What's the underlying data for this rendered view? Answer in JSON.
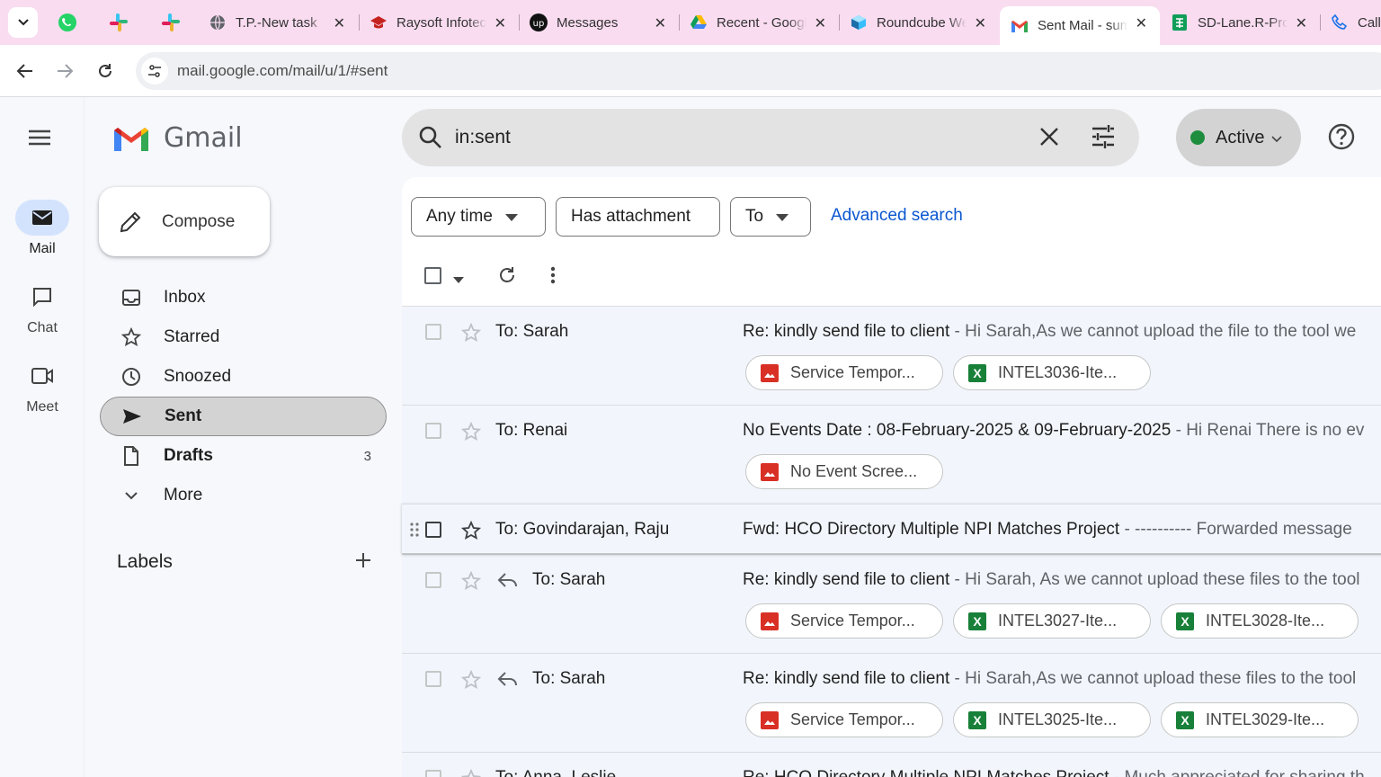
{
  "browser": {
    "tabs": [
      {
        "title": "T.P.-New task",
        "icon": "globe-icon"
      },
      {
        "title": "Raysoft Infotech",
        "icon": "graduation-cap-icon"
      },
      {
        "title": "Messages",
        "icon": "upwork-icon"
      },
      {
        "title": "Recent - Google Drive",
        "icon": "google-drive-icon"
      },
      {
        "title": "Roundcube Webmail",
        "icon": "roundcube-icon"
      },
      {
        "title": "Sent Mail - sumit",
        "icon": "gmail-icon",
        "active": true
      },
      {
        "title": "SD-Lane.R-Pro",
        "icon": "google-sheets-icon"
      },
      {
        "title": "Call",
        "icon": "phone-icon"
      }
    ],
    "url": "mail.google.com/mail/u/1/#sent"
  },
  "rail": {
    "items": [
      {
        "label": "Mail",
        "icon": "mail-icon",
        "active": true
      },
      {
        "label": "Chat",
        "icon": "chat-icon"
      },
      {
        "label": "Meet",
        "icon": "video-icon"
      }
    ]
  },
  "app": {
    "name": "Gmail"
  },
  "compose": {
    "label": "Compose"
  },
  "nav": {
    "items": [
      {
        "label": "Inbox",
        "icon": "inbox-icon"
      },
      {
        "label": "Starred",
        "icon": "star-icon"
      },
      {
        "label": "Snoozed",
        "icon": "clock-icon"
      },
      {
        "label": "Sent",
        "icon": "send-icon",
        "active": true
      },
      {
        "label": "Drafts",
        "icon": "file-icon",
        "count": "3"
      },
      {
        "label": "More",
        "icon": "chevron-down-icon"
      }
    ]
  },
  "labels": {
    "title": "Labels"
  },
  "search": {
    "query": "in:sent"
  },
  "status": {
    "label": "Active",
    "color": "#1e8e3e"
  },
  "filters": {
    "any_time": "Any time",
    "has_attachment": "Has attachment",
    "to": "To",
    "advanced": "Advanced search"
  },
  "emails": [
    {
      "sender": "To: Sarah",
      "subject": "Re: kindly send file to client",
      "snippet": " - Hi Sarah,As we cannot upload the file to the tool we",
      "reply": false,
      "attachments": [
        {
          "name": "Service Tempor...",
          "type": "image"
        },
        {
          "name": "INTEL3036-Ite...",
          "type": "excel"
        }
      ]
    },
    {
      "sender": "To: Renai",
      "subject": "No Events Date : 08-February-2025 & 09-February-2025",
      "snippet": " - Hi Renai There is no ev",
      "reply": false,
      "attachments": [
        {
          "name": "No Event Scree...",
          "type": "image"
        }
      ]
    },
    {
      "sender": "To: Govindarajan, Raju",
      "subject": "Fwd: HCO Directory Multiple NPI Matches Project",
      "snippet": " - ---------- Forwarded message",
      "reply": false,
      "hover": true,
      "attachments": []
    },
    {
      "sender": "To: Sarah",
      "subject": "Re: kindly send file to client",
      "snippet": " - Hi Sarah, As we cannot upload these files to the tool",
      "reply": true,
      "attachments": [
        {
          "name": "Service Tempor...",
          "type": "image"
        },
        {
          "name": "INTEL3027-Ite...",
          "type": "excel"
        },
        {
          "name": "INTEL3028-Ite...",
          "type": "excel"
        }
      ]
    },
    {
      "sender": "To: Sarah",
      "subject": "Re: kindly send file to client",
      "snippet": " - Hi Sarah,As we cannot upload these files to the tool",
      "reply": true,
      "attachments": [
        {
          "name": "Service Tempor...",
          "type": "image"
        },
        {
          "name": "INTEL3025-Ite...",
          "type": "excel"
        },
        {
          "name": "INTEL3029-Ite...",
          "type": "excel"
        }
      ]
    },
    {
      "sender": "To: Anna, Leslie",
      "subject": "Re: HCO Directory Multiple NPI Matches Project",
      "snippet": " - Much appreciated for sharing th",
      "reply": false,
      "attachments": []
    }
  ]
}
